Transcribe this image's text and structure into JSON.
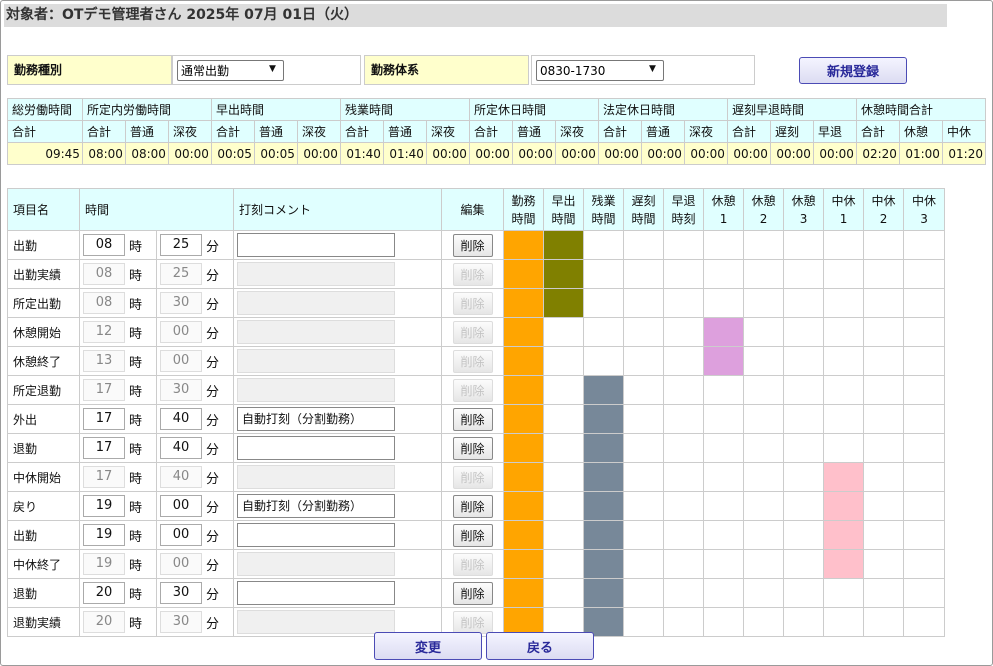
{
  "title": "対象者：OTデモ管理者さん 2025年 07月 01日（火）",
  "form": {
    "kinmu_shubetsu_label": "勤務種別",
    "kinmu_shubetsu_value": "通常出勤",
    "kinmu_taikei_label": "勤務体系",
    "kinmu_taikei_value": "0830-1730",
    "new_button": "新規登録"
  },
  "summary": {
    "groups": [
      "総労働時間",
      "所定内労働時間",
      "早出時間",
      "残業時間",
      "所定休日時間",
      "法定休日時間",
      "遅刻早退時間",
      "休憩時間合計"
    ],
    "subheaders": [
      "合計",
      "合計",
      "普通",
      "深夜",
      "合計",
      "普通",
      "深夜",
      "合計",
      "普通",
      "深夜",
      "合計",
      "普通",
      "深夜",
      "合計",
      "普通",
      "深夜",
      "合計",
      "遅刻",
      "早退",
      "合計",
      "休憩",
      "中休"
    ],
    "values": [
      "09:45",
      "08:00",
      "08:00",
      "00:00",
      "00:05",
      "00:05",
      "00:00",
      "01:40",
      "01:40",
      "00:00",
      "00:00",
      "00:00",
      "00:00",
      "00:00",
      "00:00",
      "00:00",
      "00:00",
      "00:00",
      "00:00",
      "02:20",
      "01:00",
      "01:20"
    ]
  },
  "table": {
    "headers": {
      "item": "項目名",
      "time": "時間",
      "comment": "打刻コメント",
      "edit": "編集",
      "cols": [
        [
          "勤務",
          "時間"
        ],
        [
          "早出",
          "時間"
        ],
        [
          "残業",
          "時間"
        ],
        [
          "遅刻",
          "時間"
        ],
        [
          "早退",
          "時刻"
        ],
        [
          "休憩",
          "1"
        ],
        [
          "休憩",
          "2"
        ],
        [
          "休憩",
          "3"
        ],
        [
          "中休",
          "1"
        ],
        [
          "中休",
          "2"
        ],
        [
          "中休",
          "3"
        ]
      ]
    },
    "hour_unit": "時",
    "min_unit": "分",
    "delete_label": "削除",
    "rows": [
      {
        "name": "出勤",
        "h": "08",
        "m": "25",
        "comment": "",
        "enabled": true,
        "bars": [
          "o",
          "g",
          "",
          "",
          "",
          "",
          "",
          "",
          "",
          "",
          ""
        ]
      },
      {
        "name": "出勤実績",
        "h": "08",
        "m": "25",
        "comment": "",
        "enabled": false,
        "bars": [
          "o",
          "g",
          "",
          "",
          "",
          "",
          "",
          "",
          "",
          "",
          ""
        ]
      },
      {
        "name": "所定出勤",
        "h": "08",
        "m": "30",
        "comment": "",
        "enabled": false,
        "bars": [
          "o",
          "g",
          "",
          "",
          "",
          "",
          "",
          "",
          "",
          "",
          ""
        ]
      },
      {
        "name": "休憩開始",
        "h": "12",
        "m": "00",
        "comment": "",
        "enabled": false,
        "bars": [
          "o",
          "",
          "",
          "",
          "",
          "p",
          "",
          "",
          "",
          "",
          ""
        ]
      },
      {
        "name": "休憩終了",
        "h": "13",
        "m": "00",
        "comment": "",
        "enabled": false,
        "bars": [
          "o",
          "",
          "",
          "",
          "",
          "p",
          "",
          "",
          "",
          "",
          ""
        ]
      },
      {
        "name": "所定退勤",
        "h": "17",
        "m": "30",
        "comment": "",
        "enabled": false,
        "bars": [
          "o",
          "",
          "s",
          "",
          "",
          "",
          "",
          "",
          "",
          "",
          ""
        ]
      },
      {
        "name": "外出",
        "h": "17",
        "m": "40",
        "comment": "自動打刻（分割勤務）",
        "enabled": true,
        "bars": [
          "o",
          "",
          "s",
          "",
          "",
          "",
          "",
          "",
          "",
          "",
          ""
        ]
      },
      {
        "name": "退勤",
        "h": "17",
        "m": "40",
        "comment": "",
        "enabled": true,
        "bars": [
          "o",
          "",
          "s",
          "",
          "",
          "",
          "",
          "",
          "",
          "",
          ""
        ]
      },
      {
        "name": "中休開始",
        "h": "17",
        "m": "40",
        "comment": "",
        "enabled": false,
        "bars": [
          "o",
          "",
          "s",
          "",
          "",
          "",
          "",
          "",
          "k",
          "",
          ""
        ]
      },
      {
        "name": "戻り",
        "h": "19",
        "m": "00",
        "comment": "自動打刻（分割勤務）",
        "enabled": true,
        "bars": [
          "o",
          "",
          "s",
          "",
          "",
          "",
          "",
          "",
          "k",
          "",
          ""
        ]
      },
      {
        "name": "出勤",
        "h": "19",
        "m": "00",
        "comment": "",
        "enabled": true,
        "bars": [
          "o",
          "",
          "s",
          "",
          "",
          "",
          "",
          "",
          "k",
          "",
          ""
        ]
      },
      {
        "name": "中休終了",
        "h": "19",
        "m": "00",
        "comment": "",
        "enabled": false,
        "bars": [
          "o",
          "",
          "s",
          "",
          "",
          "",
          "",
          "",
          "k",
          "",
          ""
        ]
      },
      {
        "name": "退勤",
        "h": "20",
        "m": "30",
        "comment": "",
        "enabled": true,
        "bars": [
          "o",
          "",
          "s",
          "",
          "",
          "",
          "",
          "",
          "",
          "",
          ""
        ]
      },
      {
        "name": "退勤実績",
        "h": "20",
        "m": "30",
        "comment": "",
        "enabled": false,
        "bars": [
          "o",
          "",
          "s",
          "",
          "",
          "",
          "",
          "",
          "",
          "",
          ""
        ]
      }
    ]
  },
  "footer": {
    "change_button": "変更",
    "back_button": "戻る"
  },
  "colors": {
    "kinmu": "#ffa500",
    "hayade": "#808000",
    "zangyo": "#778899",
    "kyukei": "#dda0dd",
    "chukyu": "#ffc0cb",
    "header_bg": "#e0ffff",
    "value_bg": "#ffffcc"
  }
}
